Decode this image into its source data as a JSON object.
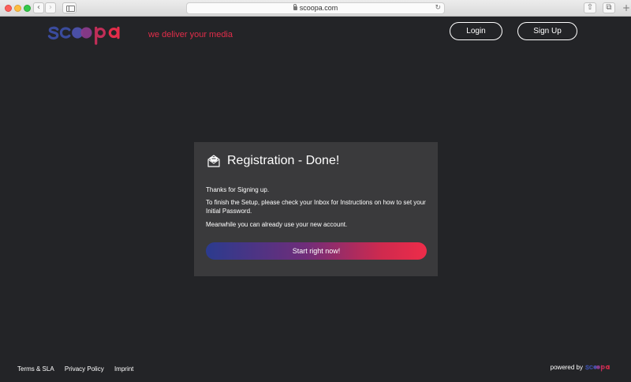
{
  "browser": {
    "url": "scoopa.com"
  },
  "header": {
    "logo_text": "scoopa",
    "tagline": "we deliver your media",
    "login_label": "Login",
    "signup_label": "Sign Up"
  },
  "card": {
    "title": "Registration - Done!",
    "p1": "Thanks for Signing up.",
    "p2": "To finish the Setup, please check your Inbox for Instructions on how to set your Initial Password.",
    "p3": "Meanwhile you can already use your new account.",
    "cta_label": "Start right now!"
  },
  "footer": {
    "links": [
      "Terms & SLA",
      "Privacy Policy",
      "Imprint"
    ],
    "powered_by": "powered by",
    "powered_logo": "scoopa"
  },
  "colors": {
    "background": "#232427",
    "card": "#3a3a3c",
    "accent_red": "#e32d4a",
    "accent_blue": "#2b3b8e"
  },
  "icons": {
    "card_icon": "envelope-open-icon",
    "lock": "lock-icon",
    "reload": "reload-icon"
  }
}
